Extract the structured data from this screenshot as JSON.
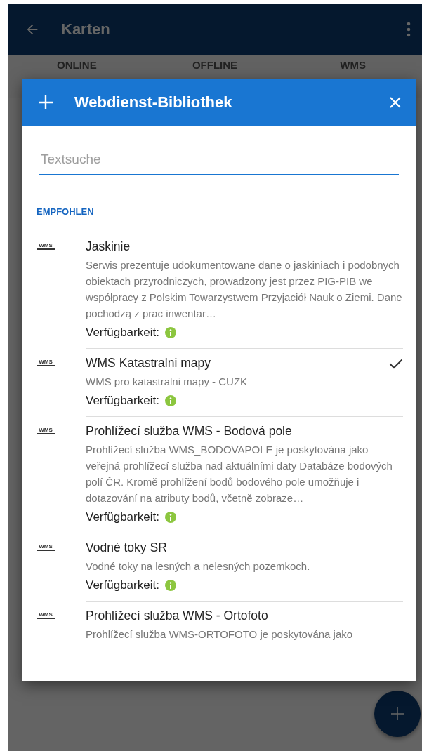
{
  "app_bar": {
    "title": "Karten"
  },
  "tabs": [
    {
      "label": "ONLINE"
    },
    {
      "label": "OFFLINE"
    },
    {
      "label": "WMS"
    }
  ],
  "dialog": {
    "title": "Webdienst-Bibliothek",
    "search": {
      "placeholder": "Textsuche"
    },
    "section": "EMPFOHLEN",
    "items": [
      {
        "icon_label": "WMS",
        "title": "Jaskinie",
        "description": "Serwis prezentuje udokumentowane dane o jaskiniach i podobnych obiektach przyrodniczych, prowadzony jest przez PIG-PIB we współpracy z Polskim Towarzystwem Przyjaciół Nauk o Ziemi. Dane pochodzą z prac inwentar…",
        "availability": "Verfügbarkeit:",
        "checked": false,
        "color": "#8cc63f"
      },
      {
        "icon_label": "WMS",
        "title": "WMS Katastralni mapy",
        "description": "WMS pro katastralni mapy - CUZK",
        "availability": "Verfügbarkeit:",
        "checked": true,
        "color": "#8cc63f"
      },
      {
        "icon_label": "WMS",
        "title": "Prohlížecí služba WMS - Bodová pole",
        "description": "Prohlížecí služba WMS_BODOVAPOLE je poskytována jako veřejná prohlížecí služba nad aktuálními daty Databáze bodových polí ČR. Kromě prohlížení bodů bodového pole umožňuje i dotazování na atributy bodů, včetně zobraze…",
        "availability": "Verfügbarkeit:",
        "checked": false,
        "color": "#8cc63f"
      },
      {
        "icon_label": "WMS",
        "title": "Vodné toky SR",
        "description": "Vodné toky na lesných a nelesných pozemkoch.",
        "availability": "Verfügbarkeit:",
        "checked": false,
        "color": "#8cc63f"
      },
      {
        "icon_label": "WMS",
        "title": "Prohlížecí služba WMS - Ortofoto",
        "description": "Prohlížecí služba WMS-ORTOFOTO je poskytována jako",
        "checked": false
      }
    ]
  }
}
